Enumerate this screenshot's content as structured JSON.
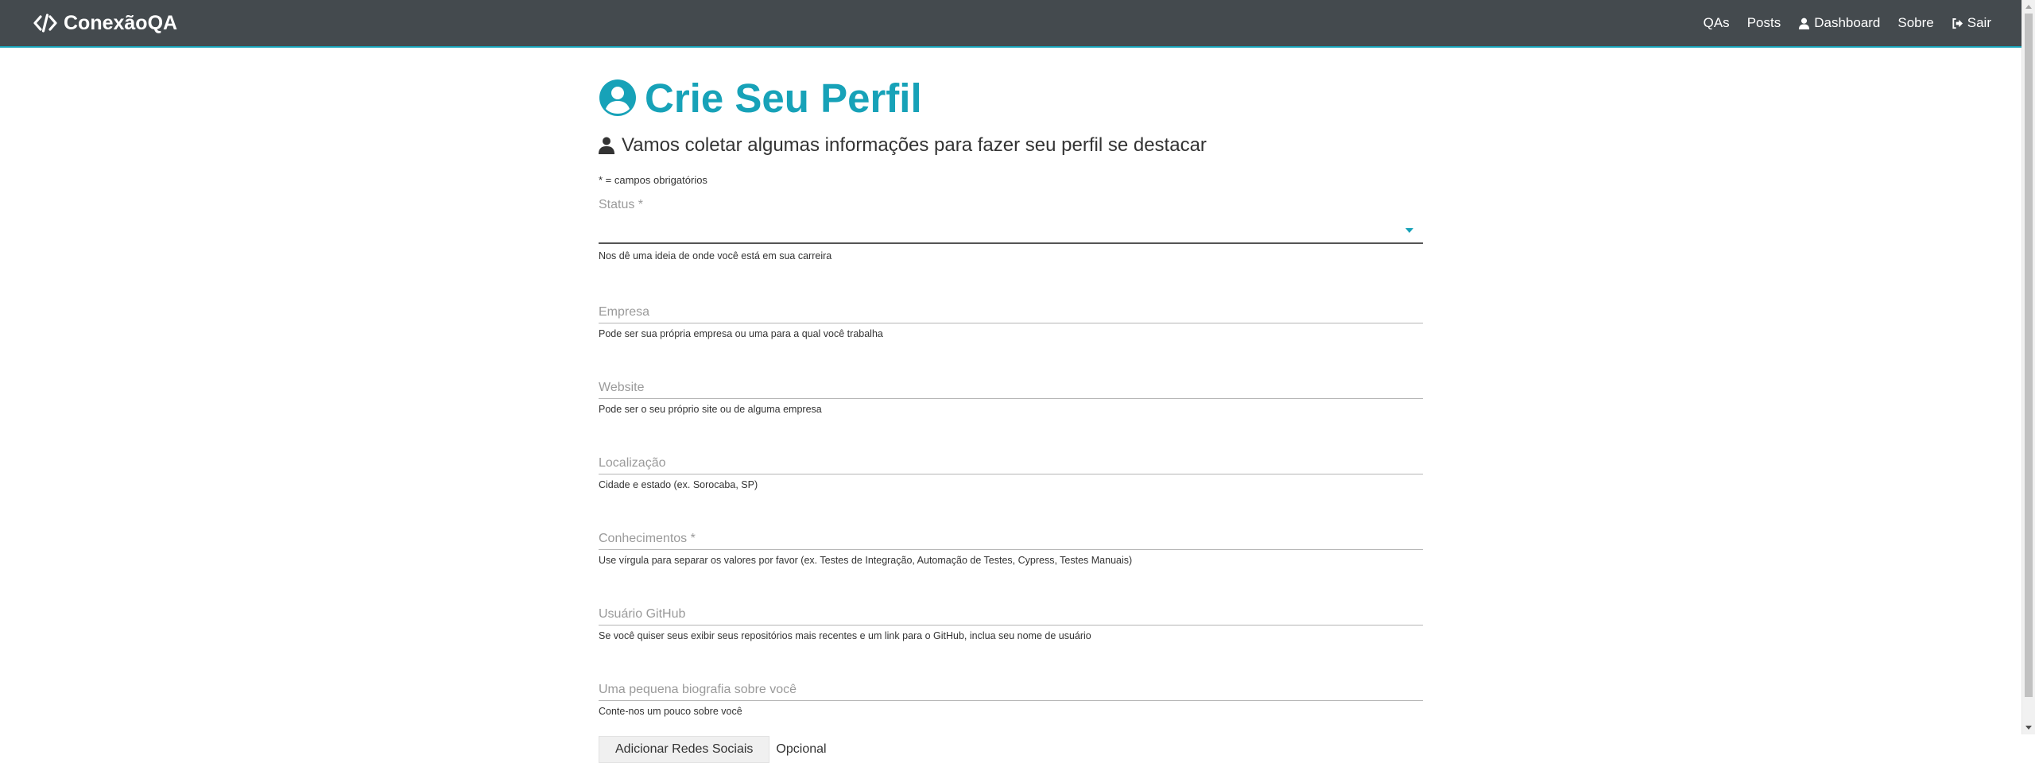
{
  "nav": {
    "brand": "ConexãoQA",
    "links": {
      "qas": "QAs",
      "posts": "Posts",
      "dashboard": "Dashboard",
      "about": "Sobre",
      "logout": "Sair"
    }
  },
  "page": {
    "title": "Crie Seu Perfil",
    "lead": "Vamos coletar algumas informações para fazer seu perfil se destacar",
    "required_note": "* = campos obrigatórios"
  },
  "form": {
    "status": {
      "label": "Status *",
      "value": "",
      "help": "Nos dê uma ideia de onde você está em sua carreira"
    },
    "company": {
      "label": "Empresa",
      "help": "Pode ser sua própria empresa ou uma para a qual você trabalha"
    },
    "website": {
      "label": "Website",
      "help": "Pode ser o seu próprio site ou de alguma empresa"
    },
    "location": {
      "label": "Localização",
      "help": "Cidade e estado (ex. Sorocaba, SP)"
    },
    "skills": {
      "label": "Conhecimentos *",
      "help": "Use vírgula para separar os valores por favor (ex. Testes de Integração, Automação de Testes, Cypress, Testes Manuais)"
    },
    "github": {
      "label": "Usuário GitHub",
      "help": "Se você quiser seus exibir seus repositórios mais recentes e um link para o GitHub, inclua seu nome de usuário"
    },
    "bio": {
      "label": "Uma pequena biografia sobre você",
      "help": "Conte-nos um pouco sobre você"
    },
    "social_button": "Adicionar Redes Sociais",
    "optional": "Opcional"
  },
  "colors": {
    "navbar": "#444a4e",
    "accent": "#17a2b8"
  }
}
